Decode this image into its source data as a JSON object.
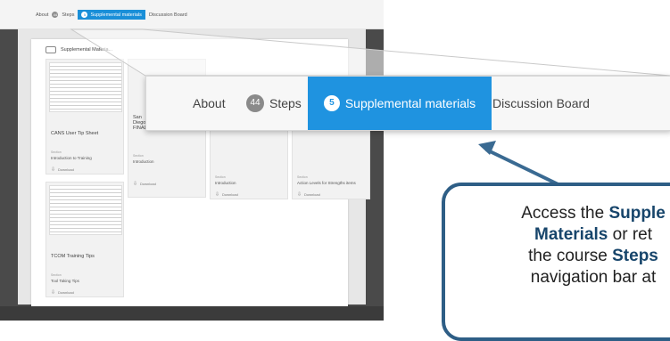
{
  "small_nav": {
    "about": "About",
    "steps_count": "44",
    "steps": "Steps",
    "supp_count": "5",
    "supp": "Supplemental materials",
    "discussion": "Discussion Board"
  },
  "panel": {
    "title": "Supplemental Materia..."
  },
  "cards": [
    {
      "title": "CANS User Tip Sheet",
      "section_label": "Section",
      "section": "Introduction to Training",
      "download": "Download"
    },
    {
      "title": "San Diego FINAL",
      "section_label": "Section",
      "section": "Introduction",
      "download": "Download"
    },
    {
      "title": "",
      "section_label": "Section",
      "section": "Introduction",
      "download": "Download"
    },
    {
      "title": "",
      "section_label": "Section",
      "section": "Action Levels for Strengths items",
      "download": "Download"
    },
    {
      "title": "TCOM Training Tips",
      "section_label": "Section",
      "section": "Tool Taking Tips",
      "download": "Download"
    }
  ],
  "zoom_nav": {
    "about": "About",
    "steps_count": "44",
    "steps": "Steps",
    "supp_count": "5",
    "supp": "Supplemental materials",
    "discussion": "Discussion Board"
  },
  "bubble": {
    "line1_a": "Access the ",
    "line1_b": "Supple",
    "line2_a": "Materials",
    "line2_b": " or ret",
    "line3_a": "the course ",
    "line3_b": "Steps",
    "line4": "navigation bar at"
  },
  "colors": {
    "active_tab": "#1f93e0",
    "bubble_border": "#2e5e86",
    "arrow": "#3a6a92"
  }
}
